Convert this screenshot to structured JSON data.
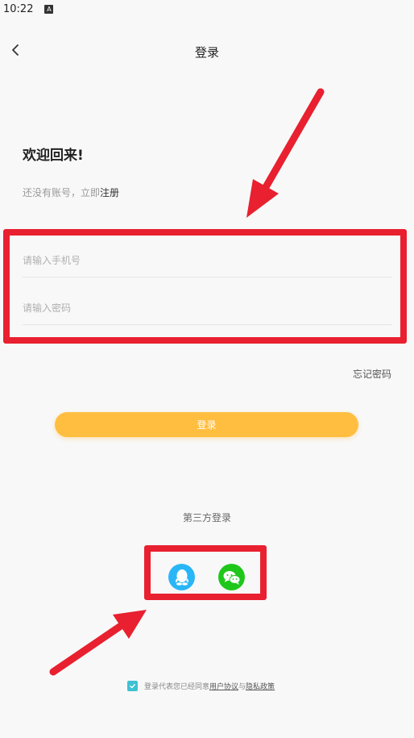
{
  "status_bar": {
    "time": "10:22",
    "notification_icon": "A"
  },
  "header": {
    "title": "登录",
    "back_icon": "chevron-left-icon"
  },
  "welcome": {
    "title": "欢迎回来!",
    "subtitle_prefix": "还没有账号，立即",
    "register_link": "注册"
  },
  "form": {
    "phone_placeholder": "请输入手机号",
    "password_placeholder": "请输入密码",
    "forgot_password": "忘记密码",
    "login_button": "登录"
  },
  "third_party": {
    "label": "第三方登录",
    "providers": [
      "qq-icon",
      "wechat-icon"
    ]
  },
  "agreement": {
    "checked": true,
    "prefix": "登录代表您已经同意",
    "user_agreement": "用户协议",
    "connector": "与",
    "privacy_policy": "隐私政策"
  },
  "colors": {
    "accent": "#ffbe40",
    "annotation": "#e8202f",
    "qq": "#29b6f6",
    "wechat": "#1fc71a",
    "checkbox": "#3ec1d3"
  }
}
